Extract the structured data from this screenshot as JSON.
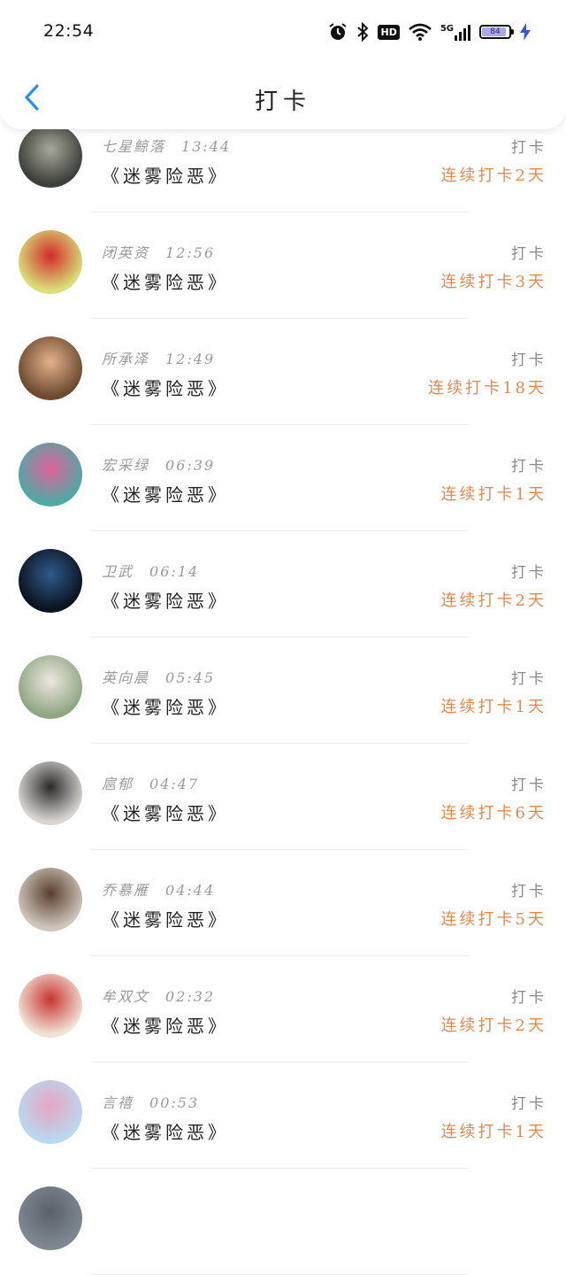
{
  "status_bar": {
    "time": "22:54",
    "network": "5G",
    "hd": "HD",
    "battery": "84"
  },
  "header": {
    "title": "打卡"
  },
  "rows": [
    {
      "name": "",
      "time": "",
      "book": "《迷雾险恶》",
      "action": "",
      "streak": "连续打卡2天",
      "avatar_colors": [
        "#e8e8e8",
        "#bdbdbd"
      ]
    },
    {
      "name": "七星鲸落",
      "time": "13:44",
      "book": "《迷雾险恶》",
      "action": "打卡",
      "streak": "连续打卡2天",
      "avatar_colors": [
        "#3b3f3a",
        "#a8a79c"
      ]
    },
    {
      "name": "闭英资",
      "time": "12:56",
      "book": "《迷雾险恶》",
      "action": "打卡",
      "streak": "连续打卡3天",
      "avatar_colors": [
        "#d8e07a",
        "#d42a2a"
      ]
    },
    {
      "name": "所承泽",
      "time": "12:49",
      "book": "《迷雾险恶》",
      "action": "打卡",
      "streak": "连续打卡18天",
      "avatar_colors": [
        "#6b4a2e",
        "#e5b18c"
      ]
    },
    {
      "name": "宏采绿",
      "time": "06:39",
      "book": "《迷雾险恶》",
      "action": "打卡",
      "streak": "连续打卡1天",
      "avatar_colors": [
        "#4fa9a4",
        "#e0619a"
      ]
    },
    {
      "name": "卫武",
      "time": "06:14",
      "book": "《迷雾险恶》",
      "action": "打卡",
      "streak": "连续打卡2天",
      "avatar_colors": [
        "#0b1220",
        "#2f5b8a"
      ]
    },
    {
      "name": "英向晨",
      "time": "05:45",
      "book": "《迷雾险恶》",
      "action": "打卡",
      "streak": "连续打卡1天",
      "avatar_colors": [
        "#8fa683",
        "#efe6df"
      ]
    },
    {
      "name": "扈郁",
      "time": "04:47",
      "book": "《迷雾险恶》",
      "action": "打卡",
      "streak": "连续打卡6天",
      "avatar_colors": [
        "#d9d6d2",
        "#2b2b2b"
      ]
    },
    {
      "name": "乔慕雁",
      "time": "04:44",
      "book": "《迷雾险恶》",
      "action": "打卡",
      "streak": "连续打卡5天",
      "avatar_colors": [
        "#cfc6bb",
        "#5a3f2f"
      ]
    },
    {
      "name": "牟双文",
      "time": "02:32",
      "book": "《迷雾险恶》",
      "action": "打卡",
      "streak": "连续打卡2天",
      "avatar_colors": [
        "#f1e2d6",
        "#c8342f"
      ]
    },
    {
      "name": "言禧",
      "time": "00:53",
      "book": "《迷雾险恶》",
      "action": "打卡",
      "streak": "连续打卡1天",
      "avatar_colors": [
        "#b9d9ef",
        "#e6a5c4"
      ]
    },
    {
      "name": "",
      "time": "",
      "book": "",
      "action": "",
      "streak": "",
      "avatar_colors": [
        "#7f8791",
        "#5a616a"
      ]
    }
  ]
}
